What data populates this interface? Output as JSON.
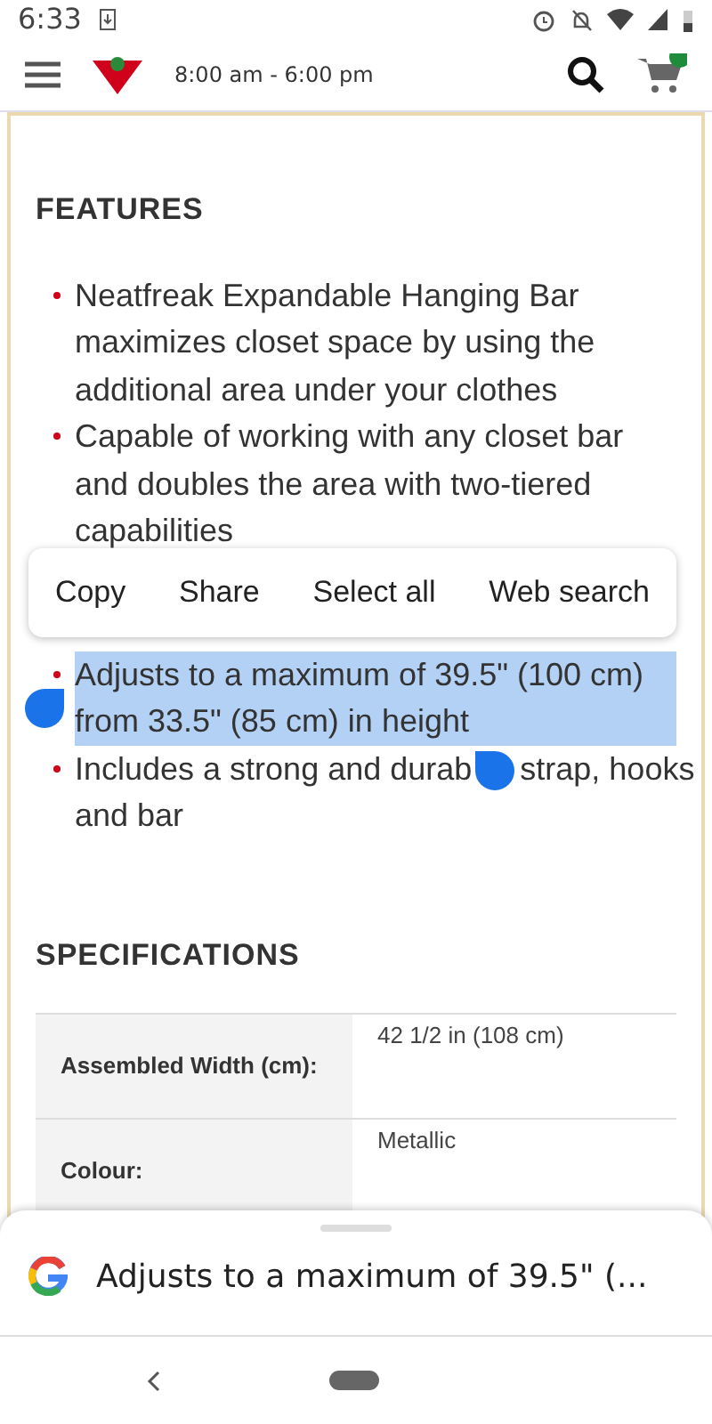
{
  "status_bar": {
    "time": "6:33"
  },
  "header": {
    "store_hours": "8:00 am - 6:00 pm"
  },
  "features": {
    "title": "FEATURES",
    "items": [
      {
        "text": "Neatfreak Expandable Hanging Bar maximizes closet space by using the additional area under your clothes",
        "selected": false
      },
      {
        "text": "Capable of working with any closet bar and doubles the area with two-tiered capabilities",
        "selected": false
      },
      {
        "text": "Adjusts to a maximum of 39.5\" (100 cm) from 33.5\" (85 cm) in height",
        "selected": true
      },
      {
        "text": "Includes a strong and durab",
        "text_after_handle": "strap, hooks",
        "text_next_line": "and bar",
        "selected": false
      }
    ]
  },
  "text_menu": [
    "Copy",
    "Share",
    "Select all",
    "Web search"
  ],
  "specifications": {
    "title": "SPECIFICATIONS",
    "rows": [
      {
        "label": "Assembled Width (cm):",
        "value": "42 1/2 in (108 cm)"
      },
      {
        "label": "Colour:",
        "value": "Metallic"
      }
    ]
  },
  "search_sheet": {
    "query": "Adjusts to a maximum of 39.5\" (..."
  }
}
